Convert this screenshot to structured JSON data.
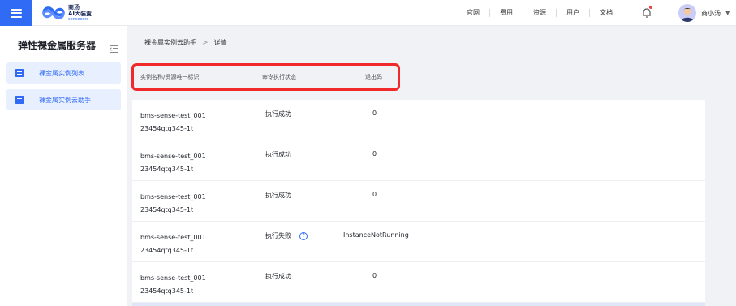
{
  "header": {
    "logo_line1": "商汤",
    "logo_line2": "AI大装置",
    "logo_line3": "sensecore",
    "nav": [
      "官网",
      "费用",
      "资源",
      "用户",
      "文档"
    ],
    "user_name": "商小汤",
    "accent": "#2f6bf4"
  },
  "sidebar": {
    "title": "弹性裸金属服务器",
    "items": [
      {
        "label": "裸金属实例列表"
      },
      {
        "label": "裸金属实例云助手"
      }
    ]
  },
  "breadcrumb": {
    "parent": "裸金属实例云助手",
    "separator": ">",
    "current": "详情"
  },
  "table": {
    "columns": [
      "实例名称/资源唯一标识",
      "命令执行状态",
      "退出码"
    ],
    "rows": [
      {
        "name": "bms-sense-test_001",
        "id": "23454qtq345-1t",
        "status": "执行成功",
        "help": false,
        "code": "0"
      },
      {
        "name": "bms-sense-test_001",
        "id": "23454qtq345-1t",
        "status": "执行成功",
        "help": false,
        "code": "0"
      },
      {
        "name": "bms-sense-test_001",
        "id": "23454qtq345-1t",
        "status": "执行成功",
        "help": false,
        "code": "0"
      },
      {
        "name": "bms-sense-test_001",
        "id": "23454qtq345-1t",
        "status": "执行失败",
        "help": true,
        "code": "InstanceNotRunning"
      },
      {
        "name": "bms-sense-test_001",
        "id": "23454qtq345-1t",
        "status": "执行成功",
        "help": false,
        "code": "0"
      }
    ],
    "help_glyph": "?"
  }
}
